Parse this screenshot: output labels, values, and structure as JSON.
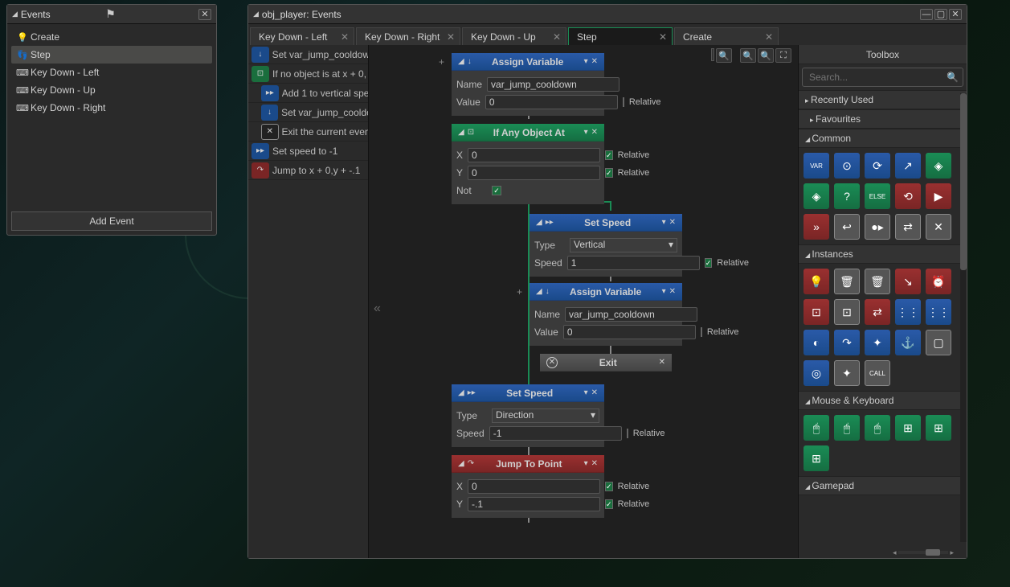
{
  "events_panel": {
    "title": "Events",
    "items": [
      {
        "icon": "💡",
        "label": "Create"
      },
      {
        "icon": "👣",
        "label": "Step",
        "selected": true
      },
      {
        "icon": "⌨",
        "label": "Key Down - Left"
      },
      {
        "icon": "⌨",
        "label": "Key Down - Up"
      },
      {
        "icon": "⌨",
        "label": "Key Down - Right"
      }
    ],
    "add_button": "Add Event"
  },
  "editor": {
    "title": "obj_player: Events",
    "tabs": [
      {
        "label": "Key Down - Left"
      },
      {
        "label": "Key Down - Right"
      },
      {
        "label": "Key Down - Up"
      },
      {
        "label": "Step",
        "active": true
      },
      {
        "label": "Create"
      }
    ],
    "action_list": [
      {
        "cls": "ic-blue",
        "icon": "VAR",
        "text": "Set var_jump_cooldow"
      },
      {
        "cls": "ic-green",
        "icon": "⊡",
        "text": "If no object is at x + 0,"
      },
      {
        "cls": "ic-blue",
        "icon": "▸▸▸",
        "text": "Add 1 to vertical spe",
        "indent": true
      },
      {
        "cls": "ic-blue",
        "icon": "VAR",
        "text": "Set var_jump_cooldo",
        "indent": true
      },
      {
        "cls": "ic-white",
        "icon": "✕",
        "text": "Exit the current even",
        "indent": true
      },
      {
        "cls": "ic-blue",
        "icon": "▸▸▸",
        "text": "Set speed to -1"
      },
      {
        "cls": "ic-red",
        "icon": "↷",
        "text": "Jump to x + 0,y + -.1"
      }
    ],
    "nodes": {
      "assign1": {
        "title": "Assign Variable",
        "name_lbl": "Name",
        "name": "var_jump_cooldown",
        "value_lbl": "Value",
        "value": "0",
        "rel": "Relative",
        "rel_on": false
      },
      "ifany": {
        "title": "If Any Object At",
        "x_lbl": "X",
        "x": "0",
        "xr": true,
        "y_lbl": "Y",
        "y": "0",
        "yr": true,
        "not_lbl": "Not",
        "not": true,
        "rel": "Relative"
      },
      "speed1": {
        "title": "Set Speed",
        "type_lbl": "Type",
        "type": "Vertical",
        "speed_lbl": "Speed",
        "speed": "1",
        "rel": "Relative",
        "rel_on": true
      },
      "assign2": {
        "title": "Assign Variable",
        "name_lbl": "Name",
        "name": "var_jump_cooldown",
        "value_lbl": "Value",
        "value": "0",
        "rel": "Relative",
        "rel_on": false
      },
      "exit": {
        "title": "Exit"
      },
      "speed2": {
        "title": "Set Speed",
        "type_lbl": "Type",
        "type": "Direction",
        "speed_lbl": "Speed",
        "speed": "-1",
        "rel": "Relative",
        "rel_on": false
      },
      "jump": {
        "title": "Jump To Point",
        "x_lbl": "X",
        "x": "0",
        "xr": true,
        "y_lbl": "Y",
        "y": "-.1",
        "yr": true,
        "rel": "Relative"
      }
    }
  },
  "toolbox": {
    "title": "Toolbox",
    "search_placeholder": "Search...",
    "sections": {
      "recent": "Recently Used",
      "fav": "Favourites",
      "common": "Common",
      "instances": "Instances",
      "mouse": "Mouse & Keyboard",
      "gamepad": "Gamepad"
    },
    "common_icons": [
      {
        "c": "tbb",
        "i": "VAR"
      },
      {
        "c": "tbb",
        "i": "⊙"
      },
      {
        "c": "tbb",
        "i": "⟳"
      },
      {
        "c": "tbb",
        "i": "↗"
      },
      {
        "c": "tbg",
        "i": "◈"
      },
      {
        "c": "tbg",
        "i": "◈"
      },
      {
        "c": "tbg",
        "i": "?"
      },
      {
        "c": "tbg",
        "i": "ELSE"
      },
      {
        "c": "tbr",
        "i": "⟲"
      },
      {
        "c": "tbr",
        "i": "▶"
      },
      {
        "c": "tbr",
        "i": "»"
      },
      {
        "c": "tbw",
        "i": "↩"
      },
      {
        "c": "tbw",
        "i": "●▸"
      },
      {
        "c": "tbw",
        "i": "⇄"
      },
      {
        "c": "tbw",
        "i": "✕"
      }
    ],
    "instances_icons": [
      {
        "c": "tbr",
        "i": "💡"
      },
      {
        "c": "tbw",
        "i": "🗑"
      },
      {
        "c": "tbw",
        "i": "🗑"
      },
      {
        "c": "tbr",
        "i": "↘"
      },
      {
        "c": "tbr",
        "i": "⏰"
      },
      {
        "c": "tbr",
        "i": "⊡"
      },
      {
        "c": "tbw",
        "i": "⊡"
      },
      {
        "c": "tbr",
        "i": "⇄"
      },
      {
        "c": "tbb",
        "i": "⋮⋮"
      },
      {
        "c": "tbb",
        "i": "⋮⋮"
      },
      {
        "c": "tbb",
        "i": "◐"
      },
      {
        "c": "tbb",
        "i": "↷"
      },
      {
        "c": "tbb",
        "i": "✦"
      },
      {
        "c": "tbb",
        "i": "⚓"
      },
      {
        "c": "tbw",
        "i": "▢"
      },
      {
        "c": "tbb",
        "i": "◎"
      },
      {
        "c": "tbw",
        "i": "✦"
      },
      {
        "c": "tbw",
        "i": "CALL"
      }
    ],
    "mouse_icons": [
      {
        "c": "tbg",
        "i": "🖱"
      },
      {
        "c": "tbg",
        "i": "🖱"
      },
      {
        "c": "tbg",
        "i": "🖱"
      },
      {
        "c": "tbg",
        "i": "⊞"
      },
      {
        "c": "tbg",
        "i": "⊞"
      },
      {
        "c": "tbg",
        "i": "⊞"
      }
    ]
  }
}
